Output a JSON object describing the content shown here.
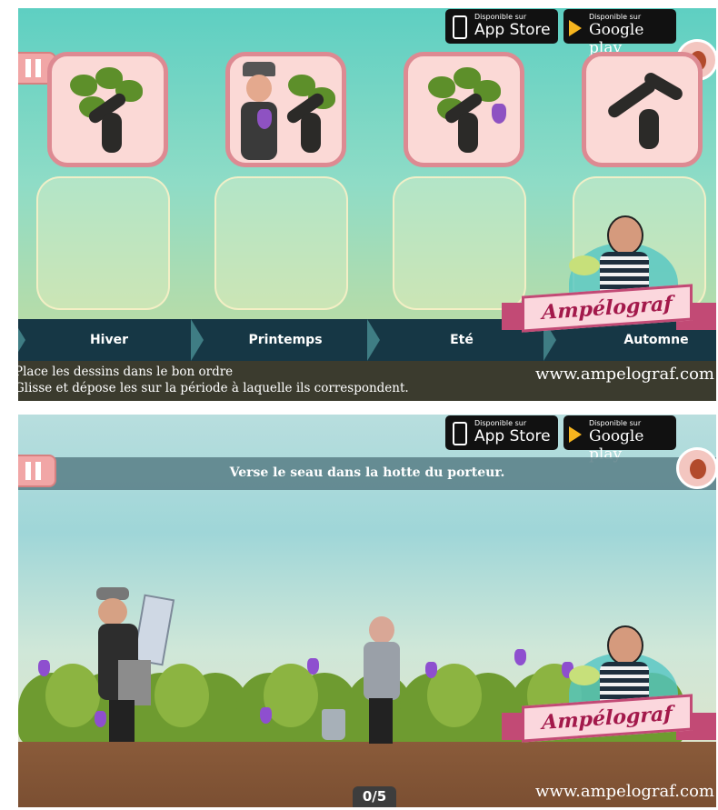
{
  "panel1": {
    "store_badges": {
      "apple_small": "Disponible sur",
      "apple_big": "App Store",
      "google_small": "Disponible sur",
      "google_big": "Google play"
    },
    "seasons": [
      "Hiver",
      "Printemps",
      "Eté",
      "Automne"
    ],
    "instruction_line1": "Place les dessins dans le bon ordre",
    "instruction_line2": "Glisse et dépose les sur la période à laquelle ils correspondent.",
    "website": "www.ampelograf.com",
    "logo_text": "Ampélograf",
    "cards": [
      {
        "icon": "vine-leafy-icon"
      },
      {
        "icon": "grape-picker-icon"
      },
      {
        "icon": "vine-with-grapes-icon"
      },
      {
        "icon": "bare-vine-icon"
      }
    ],
    "slots": 4
  },
  "panel2": {
    "store_badges": {
      "apple_small": "Disponible sur",
      "apple_big": "App Store",
      "google_small": "Disponible sur",
      "google_big": "Google play"
    },
    "hint": "Verse le seau dans la hotte du porteur.",
    "counter": "0/5",
    "website": "www.ampelograf.com",
    "logo_text": "Ampélograf"
  },
  "colors": {
    "card_border": "#dd8a92",
    "season_bar": "#163745",
    "ribbon": "#c24a75"
  }
}
